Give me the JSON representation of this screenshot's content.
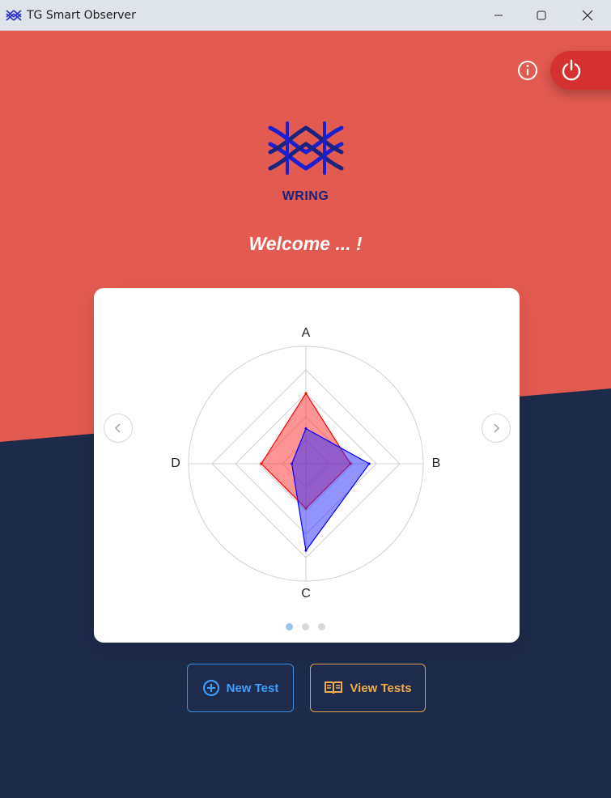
{
  "window": {
    "title": "TG Smart Observer"
  },
  "header": {
    "brand": "WRING",
    "welcome": "Welcome ... !"
  },
  "colors": {
    "top_background": "#e35a50",
    "bottom_background": "#1e2a4a",
    "power_button": "#d63131",
    "brand_text": "#1a237e",
    "series_red": "#ff0000",
    "series_blue": "#0000ff",
    "new_test_accent": "#3fa0ff",
    "view_tests_accent": "#f2ad49"
  },
  "icons": {
    "info": "info-icon",
    "power": "power-icon",
    "prev": "chevron-left-icon",
    "next": "chevron-right-icon",
    "new_test": "plus-circle-icon",
    "view_tests": "open-book-icon"
  },
  "chart_data": {
    "type": "radar",
    "categories": [
      "A",
      "B",
      "C",
      "D"
    ],
    "rmax": 5,
    "grid_levels": [
      1,
      2,
      3,
      4
    ],
    "outer_circle": true,
    "series": [
      {
        "values": [
          3.0,
          1.9,
          1.9,
          1.9
        ],
        "color": "#ff0000",
        "fill": "rgba(255,60,60,0.55)"
      },
      {
        "values": [
          1.5,
          2.7,
          3.7,
          0.6
        ],
        "color": "#0000ff",
        "fill": "rgba(40,40,255,0.5)"
      }
    ]
  },
  "carousel": {
    "pages": 3,
    "active": 0
  },
  "actions": {
    "new_test": "New Test",
    "view_tests": "View Tests"
  }
}
